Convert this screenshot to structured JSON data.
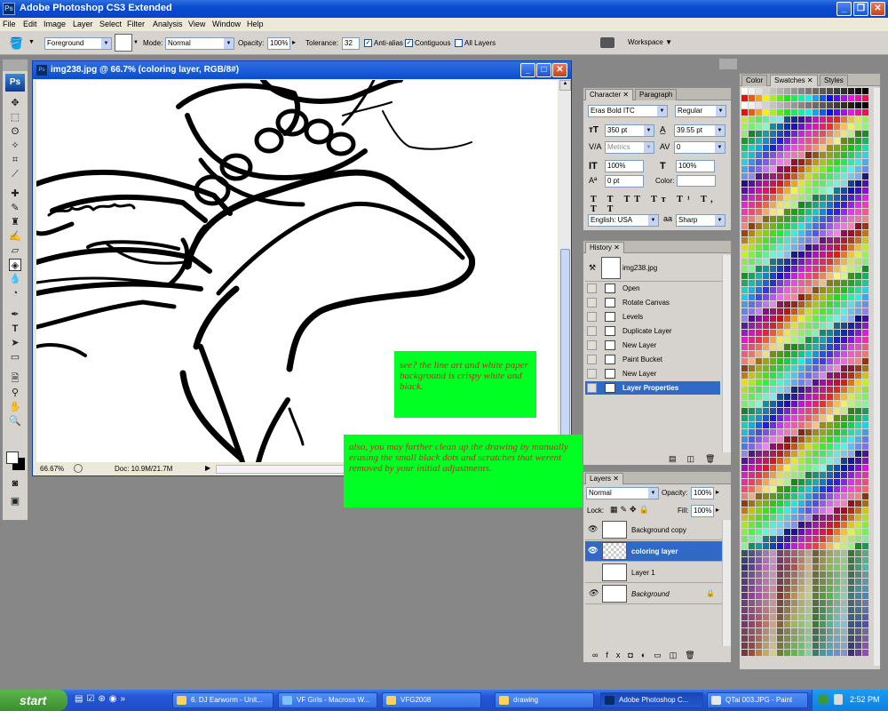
{
  "app": {
    "title": "Adobe Photoshop CS3 Extended",
    "logo": "Ps"
  },
  "menu": [
    "File",
    "Edit",
    "Image",
    "Layer",
    "Select",
    "Filter",
    "Analysis",
    "View",
    "Window",
    "Help"
  ],
  "options": {
    "fill_source": "Foreground",
    "mode_label": "Mode:",
    "mode": "Normal",
    "opacity_label": "Opacity:",
    "opacity": "100%",
    "tolerance_label": "Tolerance:",
    "tolerance": "32",
    "antialias": "Anti-alias",
    "contiguous": "Contiguous",
    "all_layers": "All Layers",
    "workspace": "Workspace"
  },
  "document": {
    "title": "img238.jpg @ 66.7% (coloring layer, RGB/8#)",
    "zoom": "66.67%",
    "doc_info": "Doc: 10.9M/21.7M"
  },
  "notes": [
    {
      "text": "see? the line art and white paper background is crispy  white and black."
    },
    {
      "text": "also, you may further clean up the drawing by manually erasing the small black dots and scratches that werent removed by your initial  adjustments."
    }
  ],
  "character": {
    "tabs": [
      "Character",
      "Paragraph"
    ],
    "font": "Eras Bold ITC",
    "style": "Regular",
    "size": "350 pt",
    "leading": "39.55 pt",
    "kerning": "Metrics",
    "tracking": "0",
    "vscale": "100%",
    "hscale": "100%",
    "baseline": "0 pt",
    "color_label": "Color:",
    "language": "English: USA",
    "antialias": "Sharp",
    "aa_label": "aa"
  },
  "history": {
    "tab": "History",
    "snapshot": "img238.jpg",
    "items": [
      "Open",
      "Rotate Canvas",
      "Levels",
      "Duplicate Layer",
      "New Layer",
      "Paint Bucket",
      "New Layer",
      "Layer Properties"
    ]
  },
  "layers": {
    "tab": "Layers",
    "mode": "Normal",
    "opacity_label": "Opacity:",
    "opacity": "100%",
    "lock_label": "Lock:",
    "fill_label": "Fill:",
    "fill": "100%",
    "items": [
      {
        "name": "Background copy",
        "visible": true,
        "selected": false
      },
      {
        "name": "coloring layer",
        "visible": true,
        "selected": true
      },
      {
        "name": "Layer 1",
        "visible": false,
        "selected": false
      },
      {
        "name": "Background",
        "visible": true,
        "selected": false,
        "locked": true
      }
    ]
  },
  "swatches": {
    "tabs": [
      "Color",
      "Swatches",
      "Styles"
    ]
  },
  "taskbar": {
    "start": "start",
    "tasks": [
      "6. DJ Earworm - Unit...",
      "VF Girls - Macross W...",
      "VFG2008",
      "drawing",
      "Adobe Photoshop C...",
      "QTai 003.JPG - Paint"
    ],
    "clock": "2:52 PM"
  },
  "colors": {
    "title_blue": "#0a4cd0",
    "note_green": "#00ff22",
    "note_text": "#d42020",
    "selection": "#3169c6"
  }
}
